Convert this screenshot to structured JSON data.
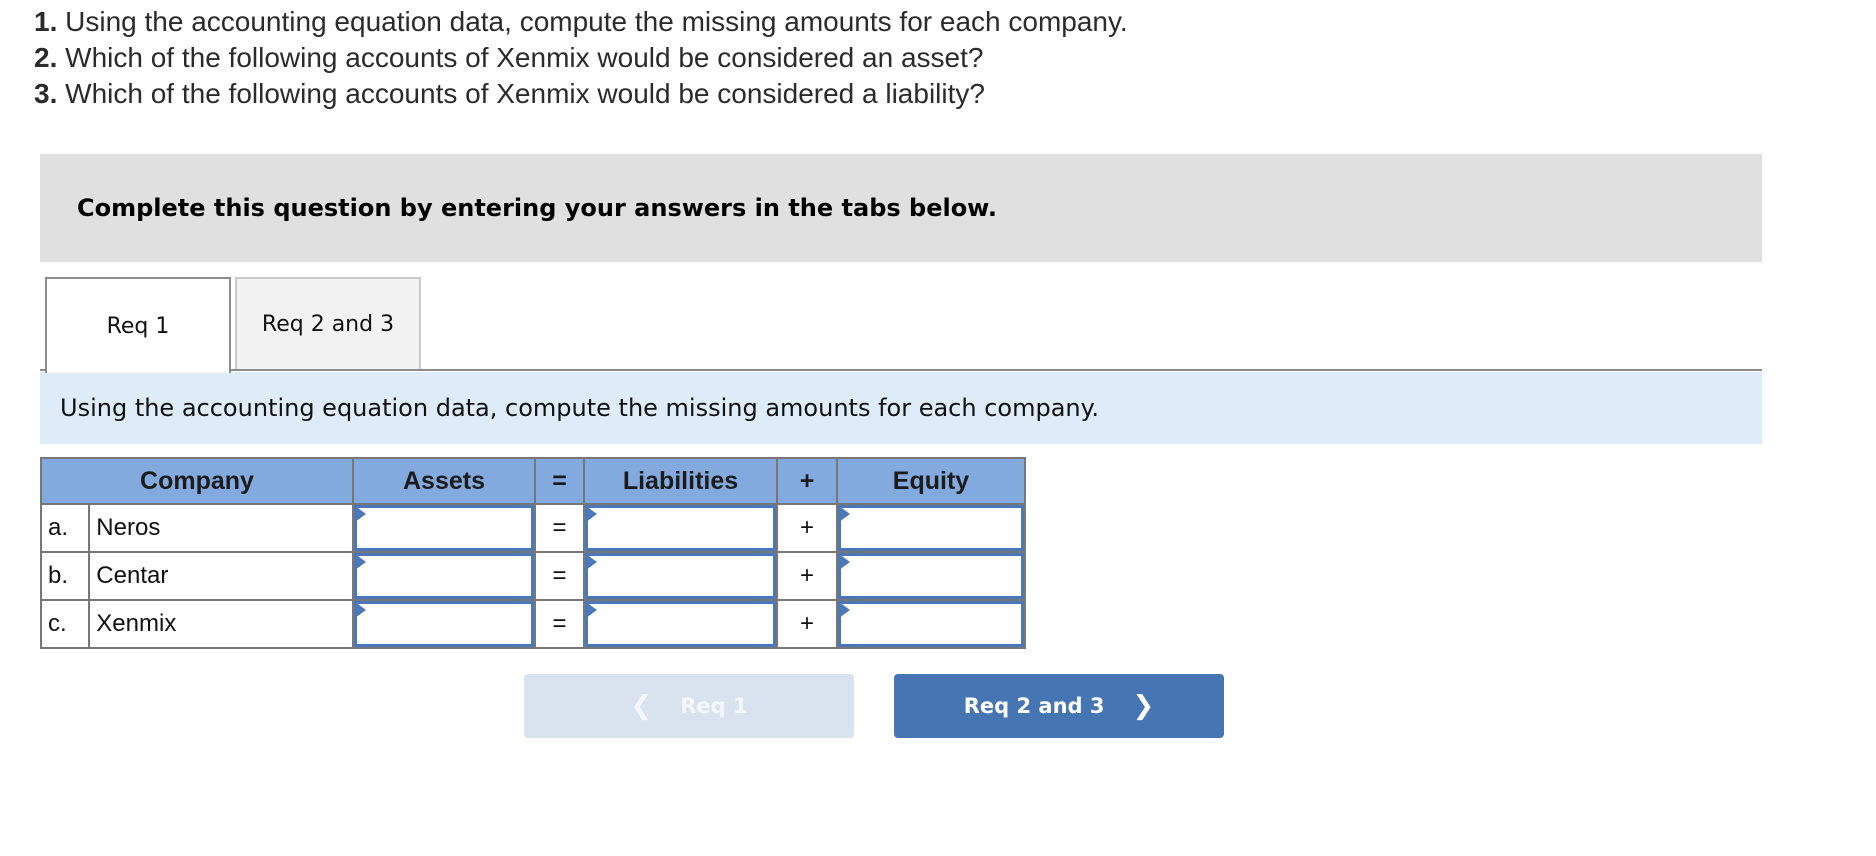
{
  "questions": [
    {
      "number": "1.",
      "text": " Using the accounting equation data, compute the missing amounts for each company."
    },
    {
      "number": "2.",
      "text": " Which of the following accounts of Xenmix would be considered an asset?"
    },
    {
      "number": "3.",
      "text": " Which of the following accounts of Xenmix would be considered a liability?"
    }
  ],
  "instructions": "Complete this question by entering your answers in the tabs below.",
  "tabs": [
    {
      "label": "Req 1",
      "active": true
    },
    {
      "label": "Req 2 and 3",
      "active": false
    }
  ],
  "prompt": "Using the accounting equation data, compute the missing amounts for each company.",
  "table": {
    "headers": {
      "company": "Company",
      "assets": "Assets",
      "eq": "=",
      "liabilities": "Liabilities",
      "plus": "+",
      "equity": "Equity"
    },
    "rows": [
      {
        "letter": "a.",
        "company": "Neros",
        "eq": "=",
        "plus": "+",
        "assets": "",
        "liabilities": "",
        "equity": ""
      },
      {
        "letter": "b.",
        "company": "Centar",
        "eq": "=",
        "plus": "+",
        "assets": "",
        "liabilities": "",
        "equity": ""
      },
      {
        "letter": "c.",
        "company": "Xenmix",
        "eq": "=",
        "plus": "+",
        "assets": "",
        "liabilities": "",
        "equity": ""
      }
    ]
  },
  "nav": {
    "prev_label": "Req 1",
    "prev_icon": "chevron-left-icon",
    "next_label": "Req 2 and 3",
    "next_icon": "chevron-right-icon"
  },
  "colors": {
    "header_blue": "#82aadf",
    "input_border": "#4a78b8",
    "next_button": "#4675b3",
    "prev_button_disabled": "#d9e3ef",
    "prompt_bg": "#ddecf8",
    "instructions_bg": "#e0e0e0"
  }
}
